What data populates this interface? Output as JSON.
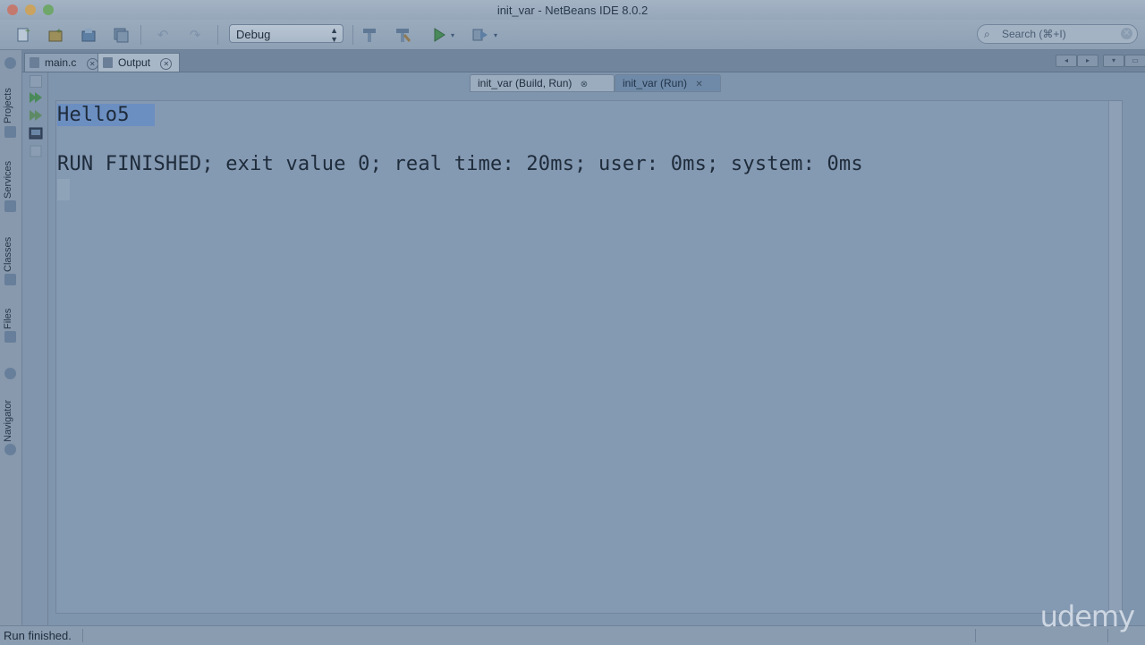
{
  "window": {
    "title": "init_var - NetBeans IDE 8.0.2"
  },
  "toolbar": {
    "configuration": "Debug",
    "search_placeholder": "Search (⌘+I)",
    "icons": [
      "new-file-icon",
      "new-project-icon",
      "open-project-icon",
      "save-all-icon",
      "undo-icon",
      "redo-icon",
      "build-hammer-icon",
      "clean-build-icon",
      "run-icon",
      "debug-icon"
    ]
  },
  "side_panels": [
    "Projects",
    "Services",
    "Classes",
    "Files",
    "Navigator"
  ],
  "doc_tabs": [
    {
      "label": "main.c"
    },
    {
      "label": "Output"
    }
  ],
  "output": {
    "sub_tabs": [
      {
        "label": "init_var (Build, Run)"
      },
      {
        "label": "init_var (Run)"
      }
    ],
    "lines": [
      "Hello5",
      "RUN FINISHED; exit value 0; real time: 20ms; user: 0ms; system: 0ms"
    ]
  },
  "status": {
    "text": "Run finished."
  },
  "watermark": "udemy"
}
